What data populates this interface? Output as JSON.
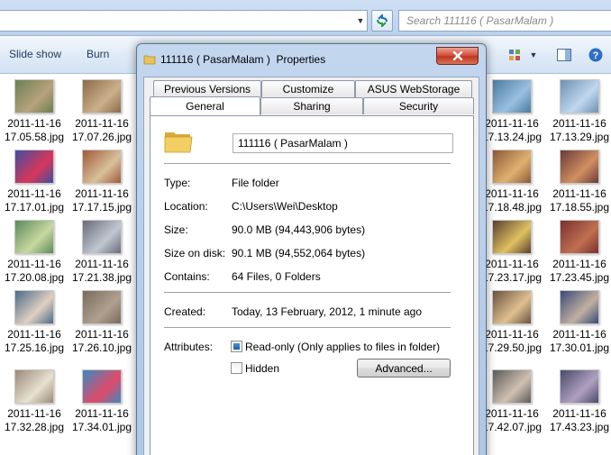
{
  "search": {
    "placeholder": "Search 111116 ( PasarMalam )"
  },
  "toolbar": {
    "slideshow_label": "Slide show",
    "burn_label": "Burn"
  },
  "files": [
    {
      "label": "2011-11-16\n17.05.58.jpg"
    },
    {
      "label": "2011-11-16\n17.07.26.jpg"
    },
    {
      "label": "2011-11-16\n17.17.01.jpg"
    },
    {
      "label": "2011-11-16\n17.17.15.jpg"
    },
    {
      "label": "2011-11-16\n17.20.08.jpg"
    },
    {
      "label": "2011-11-16\n17.21.38.jpg"
    },
    {
      "label": "2011-11-16\n17.25.16.jpg"
    },
    {
      "label": "2011-11-16\n17.26.10.jpg"
    },
    {
      "label": "2011-11-16\n17.32.28.jpg"
    },
    {
      "label": "2011-11-16\n17.34.01.jpg"
    },
    {
      "label": "2011-11-16\n17.13.24.jpg"
    },
    {
      "label": "2011-11-16\n17.13.29.jpg"
    },
    {
      "label": "2011-11-16\n17.18.48.jpg"
    },
    {
      "label": "2011-11-16\n17.18.55.jpg"
    },
    {
      "label": "2011-11-16\n17.23.17.jpg"
    },
    {
      "label": "2011-11-16\n17.23.45.jpg"
    },
    {
      "label": "2011-11-16\n17.29.50.jpg"
    },
    {
      "label": "2011-11-16\n17.30.01.jpg"
    },
    {
      "label": "2011-11-16\n17.42.07.jpg"
    },
    {
      "label": "2011-11-16\n17.43.23.jpg"
    }
  ],
  "dialog": {
    "title": "111116 ( PasarMalam )  Properties",
    "tabs": {
      "previous_versions": "Previous Versions",
      "customize": "Customize",
      "asus_webstorage": "ASUS WebStorage",
      "general": "General",
      "sharing": "Sharing",
      "security": "Security"
    },
    "folder_name": "111116 ( PasarMalam )",
    "type_label": "Type:",
    "type_value": "File folder",
    "location_label": "Location:",
    "location_value": "C:\\Users\\Wei\\Desktop",
    "size_label": "Size:",
    "size_value": "90.0 MB (94,443,906 bytes)",
    "size_on_disk_label": "Size on disk:",
    "size_on_disk_value": "90.1 MB (94,552,064 bytes)",
    "contains_label": "Contains:",
    "contains_value": "64 Files, 0 Folders",
    "created_label": "Created:",
    "created_value": "Today, 13 February, 2012, 1 minute ago",
    "attributes_label": "Attributes:",
    "readonly_label": "Read-only (Only applies to files in folder)",
    "readonly_state": "indeterminate",
    "hidden_label": "Hidden",
    "hidden_checked": false,
    "advanced_label": "Advanced..."
  },
  "colors": {
    "title_bar": "#b9d1ec",
    "close_button": "#c0361f",
    "tab_face": "#f0f0f0"
  },
  "icons": [
    "refresh-icon",
    "folder-icon",
    "close-icon",
    "view-icon",
    "preview-pane-icon",
    "help-icon"
  ]
}
